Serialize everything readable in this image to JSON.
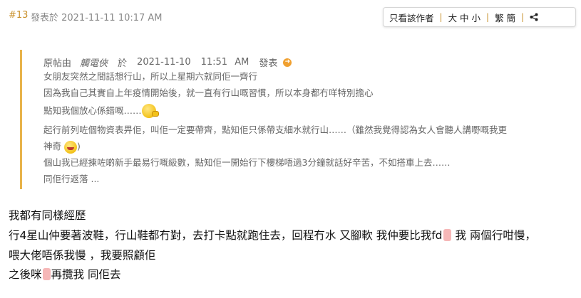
{
  "post": {
    "floor": "#13",
    "meta": "發表於 2021-11-11 10:17 AM"
  },
  "toolbar": {
    "author_only": "只看該作者",
    "font_size": "大 中 小",
    "traditional_simplified": "繁 簡",
    "share_icon": "share-icon"
  },
  "quote": {
    "prefix": "原帖由",
    "author": "觸電俠",
    "yu": "於",
    "date": "2021-11-10",
    "time": "11:51 AM",
    "published": "發表",
    "jump_icon": "arrow-jump-icon",
    "lines": [
      "女朋友突然之間話想行山，所以上星期六就同佢一齊行",
      "因為我自己其實自上年疫情開始後，就一直有行山嘅習慣，所以本身都冇咩特別擔心",
      "點知我個放心係錯嘅……",
      "起行前列咗個物資表畀佢，叫佢一定要帶齊，點知佢只係帶支細水就行山……（雖然我覺得認為女人會聽人講嘢嘅我更",
      "神奇",
      ")",
      "個山我已經揀咗啲新手最易行嘅級數，點知佢一開始行下樓梯唔過3分鐘就話好辛苦，不如搭車上去……",
      "同佢行返落   ..."
    ]
  },
  "reply": {
    "lines": [
      "我都有同樣經歷",
      "行4星山仲要著波鞋，行山鞋都冇對，去打卡點就跑住去，回程冇水  又腳軟  我仲要比我fd",
      "  我   兩個行咁慢，",
      "喂大佬唔係我慢    ，我要照顧佢",
      "之後咪",
      "再攬我   同佢去"
    ]
  }
}
